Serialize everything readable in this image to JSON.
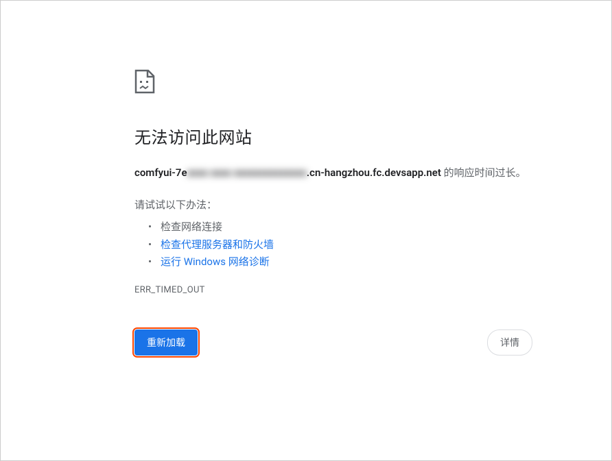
{
  "title": "无法访问此网站",
  "message": {
    "hostname_prefix": "comfyui-7e",
    "hostname_blurred": "xxxx xxxx xxxxxxxxxxxxxx",
    "hostname_suffix": ".cn-hangzhou.fc.devsapp.net",
    "status_text": " 的响应时间过长。"
  },
  "suggestions": {
    "intro": "请试试以下办法：",
    "items": [
      {
        "label": "检查网络连接",
        "type": "plain"
      },
      {
        "label": "检查代理服务器和防火墙",
        "type": "link"
      },
      {
        "label": "运行 Windows 网络诊断",
        "type": "link"
      }
    ]
  },
  "error_code": "ERR_TIMED_OUT",
  "buttons": {
    "reload": "重新加载",
    "details": "详情"
  }
}
